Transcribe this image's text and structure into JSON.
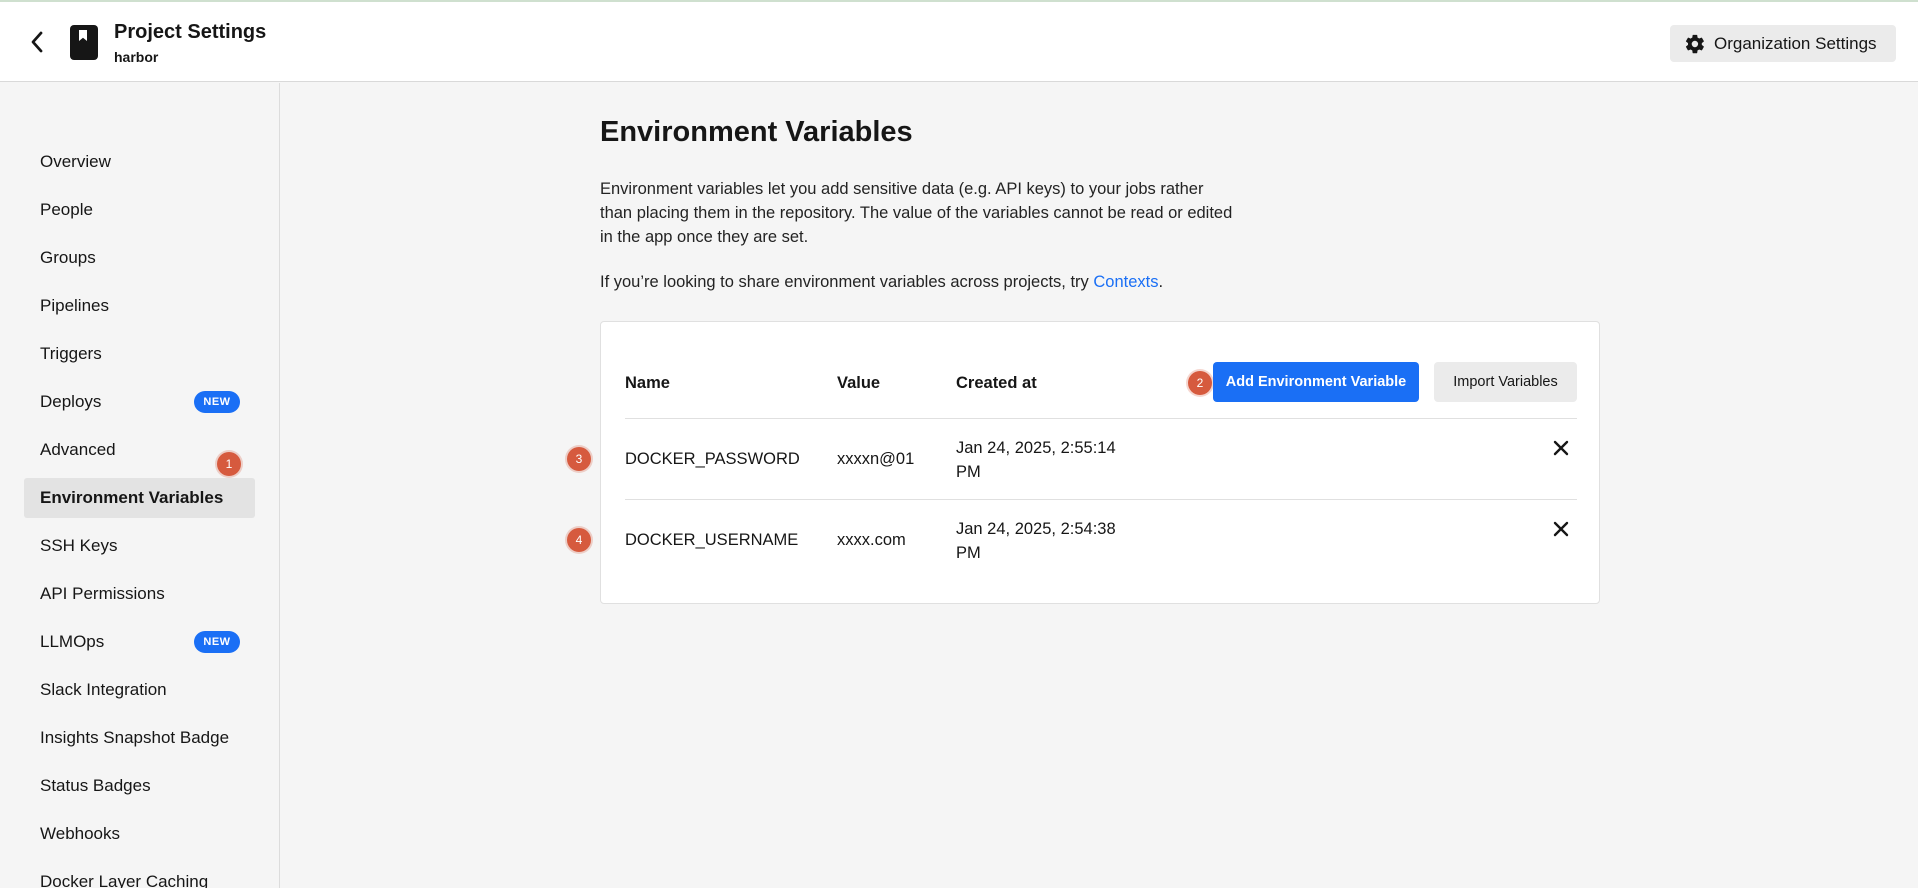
{
  "header": {
    "title": "Project Settings",
    "subtitle": "harbor",
    "org_settings_label": "Organization Settings"
  },
  "sidebar": {
    "items": [
      {
        "label": "Overview"
      },
      {
        "label": "People"
      },
      {
        "label": "Groups"
      },
      {
        "label": "Pipelines"
      },
      {
        "label": "Triggers"
      },
      {
        "label": "Deploys",
        "badge": "NEW"
      },
      {
        "label": "Advanced"
      },
      {
        "label": "Environment Variables",
        "active": true
      },
      {
        "label": "SSH Keys"
      },
      {
        "label": "API Permissions"
      },
      {
        "label": "LLMOps",
        "badge": "NEW"
      },
      {
        "label": "Slack Integration"
      },
      {
        "label": "Insights Snapshot Badge"
      },
      {
        "label": "Status Badges"
      },
      {
        "label": "Webhooks"
      },
      {
        "label": "Docker Layer Caching"
      }
    ]
  },
  "markers": [
    "1",
    "2",
    "3",
    "4"
  ],
  "main": {
    "title": "Environment Variables",
    "description": "Environment variables let you add sensitive data (e.g. API keys) to your jobs rather than placing them in the repository. The value of the variables cannot be read or edited in the app once they are set.",
    "share_prefix": "If you’re looking to share environment variables across projects, try ",
    "share_link": "Contexts",
    "share_suffix": "."
  },
  "table": {
    "headers": {
      "name": "Name",
      "value": "Value",
      "created": "Created at"
    },
    "add_button": "Add Environment Variable",
    "import_button": "Import Variables",
    "rows": [
      {
        "name": "DOCKER_PASSWORD",
        "value": "xxxxn@01",
        "created": "Jan 24, 2025, 2:55:14 PM"
      },
      {
        "name": "DOCKER_USERNAME",
        "value": "xxxx.com",
        "created": "Jan 24, 2025, 2:54:38 PM"
      }
    ]
  },
  "colors": {
    "accent": "#1a6ff5",
    "marker": "#d65a3e",
    "background": "#f5f5f5"
  }
}
